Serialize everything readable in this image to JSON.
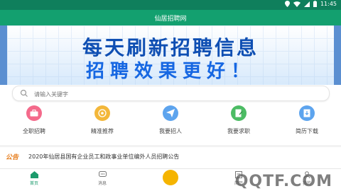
{
  "statusbar": {
    "time": "11:45"
  },
  "appbar": {
    "title": "仙居招聘网"
  },
  "banner": {
    "line1": "每天刷新招聘信息",
    "line2": "招聘效果更好！"
  },
  "search": {
    "placeholder": "请输入关键字"
  },
  "menu": [
    {
      "label": "全职招聘",
      "icon": "briefcase-icon",
      "color": "#f46a8b"
    },
    {
      "label": "精准推荐",
      "icon": "target-icon",
      "color": "#f3b73a"
    },
    {
      "label": "我要招人",
      "icon": "paper-plane-icon",
      "color": "#5da4ee"
    },
    {
      "label": "我要求职",
      "icon": "edit-doc-icon",
      "color": "#4cbc64"
    },
    {
      "label": "简历下载",
      "icon": "download-icon",
      "color": "#5da4ee"
    }
  ],
  "notice": {
    "tag": "公告",
    "text": "2020年仙居县国有企业员工和政事业单位编外人员招聘公告"
  },
  "tabbar": [
    {
      "label": "首页",
      "icon": "home-icon",
      "active": true
    },
    {
      "label": "消息",
      "icon": "chat-icon",
      "active": false
    },
    {
      "label": "",
      "icon": "center-icon",
      "active": false
    },
    {
      "label": "简历",
      "icon": "resume-icon",
      "active": false
    },
    {
      "label": "我的",
      "icon": "user-icon",
      "active": false
    }
  ],
  "watermark": "QQTF.COM",
  "colors": {
    "primary": "#13a06f",
    "status": "#0f7f5c",
    "accent": "#f5b400",
    "notice": "#e67c1b"
  }
}
